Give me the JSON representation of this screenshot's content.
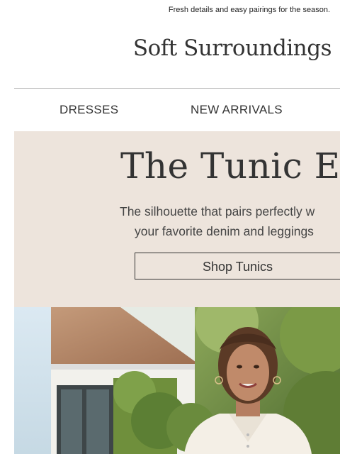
{
  "preheader": "Fresh details and easy pairings for the season.",
  "brand": "Soft Surroundings",
  "nav": {
    "items": [
      {
        "label": "DRESSES"
      },
      {
        "label": "NEW ARRIVALS"
      }
    ]
  },
  "hero": {
    "title": "The Tunic Edi",
    "subtitle_lines": [
      "The silhouette that pairs perfectly w",
      "your favorite denim and leggings"
    ],
    "cta_label": "Shop Tunics",
    "background": "#ede4dc"
  }
}
